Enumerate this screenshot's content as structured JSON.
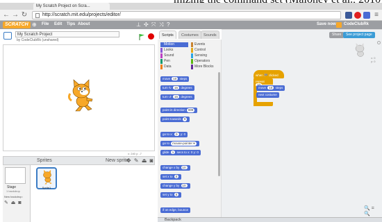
{
  "caption": {
    "text": "mizing the command set (Maloney et al., 2010)."
  },
  "browser": {
    "tab_title": "My Scratch Project on Scra...",
    "url": "http://scratch.mit.edu/projects/editor/"
  },
  "menubar": {
    "logo": "SCRATCH",
    "items": [
      "File",
      "Edit",
      "Tips",
      "About"
    ],
    "save_label": "Save now",
    "user": "CodeClubRk"
  },
  "project": {
    "title": "My Scratch Project",
    "byline": "by CodeClubRk (unshared)"
  },
  "stage": {
    "coords": "x: 240  y: -7"
  },
  "sprites": {
    "title": "Sprites",
    "new_sprite_label": "New sprite:",
    "stage_label": "Stage",
    "backdrop_count": "1 backdrop",
    "new_backdrop_label": "New backdrop:",
    "items": [
      {
        "name": "Sprite1"
      }
    ]
  },
  "palette": {
    "tabs": [
      "Scripts",
      "Costumes",
      "Sounds"
    ],
    "active_tab": "Scripts",
    "categories": [
      {
        "name": "Motion",
        "color": "#4a6cd4"
      },
      {
        "name": "Events",
        "color": "#c88330"
      },
      {
        "name": "Looks",
        "color": "#8a55d7"
      },
      {
        "name": "Control",
        "color": "#e1a91a"
      },
      {
        "name": "Sound",
        "color": "#bb42c3"
      },
      {
        "name": "Sensing",
        "color": "#2ca5e2"
      },
      {
        "name": "Pen",
        "color": "#0e9a6c"
      },
      {
        "name": "Operators",
        "color": "#5cb712"
      },
      {
        "name": "Data",
        "color": "#ee7d16"
      },
      {
        "name": "More Blocks",
        "color": "#632d99"
      }
    ],
    "active_category": "Motion",
    "blocks": [
      {
        "parts": [
          "move",
          "10",
          "steps"
        ]
      },
      {
        "parts": [
          "turn ↻",
          "15",
          "degrees"
        ]
      },
      {
        "parts": [
          "turn ↺",
          "15",
          "degrees"
        ]
      },
      {
        "parts": [
          "point in direction",
          "90▾",
          ""
        ]
      },
      {
        "parts": [
          "point towards",
          "▾",
          ""
        ]
      },
      {
        "parts": [
          "go to x:",
          "0",
          "y: 0"
        ]
      },
      {
        "parts": [
          "go to",
          "mouse-pointer ▾",
          ""
        ]
      },
      {
        "parts": [
          "glide",
          "1",
          "secs to x: 0 y: 0"
        ]
      },
      {
        "parts": [
          "change x by",
          "10",
          ""
        ]
      },
      {
        "parts": [
          "set x to",
          "0",
          ""
        ]
      },
      {
        "parts": [
          "change y by",
          "10",
          ""
        ]
      },
      {
        "parts": [
          "set y to",
          "0",
          ""
        ]
      },
      {
        "parts": [
          "if on edge, bounce",
          "",
          ""
        ]
      }
    ]
  },
  "scripts": {
    "share_label": "Share",
    "project_page_label": "See project page",
    "sprite_x": "x: 0",
    "sprite_y": "y: 0",
    "script": {
      "hat": "when 🏁 clicked",
      "repeat_label": "repeat",
      "repeat_count": "10",
      "inner": [
        {
          "parts": [
            "move",
            "10",
            "steps"
          ]
        },
        {
          "parts": [
            "next costume",
            "",
            ""
          ]
        }
      ]
    }
  },
  "backpack": {
    "label": "Backpack"
  },
  "colors": {
    "motion": "#4a6cd4",
    "control": "#e6a200",
    "menubar": "#9c9ea2"
  }
}
